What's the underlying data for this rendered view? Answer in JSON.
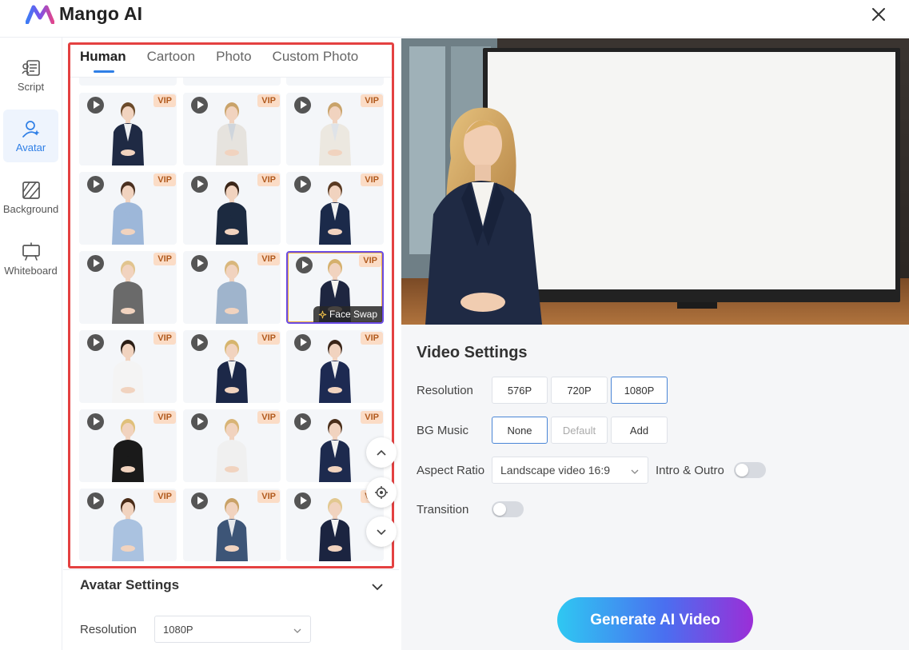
{
  "app": {
    "name": "Mango AI"
  },
  "sidebar": {
    "items": [
      {
        "label": "Script",
        "icon": "script-icon"
      },
      {
        "label": "Avatar",
        "icon": "avatar-icon",
        "active": true
      },
      {
        "label": "Background",
        "icon": "background-icon"
      },
      {
        "label": "Whiteboard",
        "icon": "whiteboard-icon"
      }
    ]
  },
  "avatar_panel": {
    "tabs": [
      "Human",
      "Cartoon",
      "Photo",
      "Custom Photo"
    ],
    "active_tab": "Human",
    "badge": "VIP",
    "face_swap_label": "Face Swap",
    "selected_index": 5
  },
  "avatar_settings": {
    "title": "Avatar Settings",
    "resolution_label": "Resolution",
    "resolution_value": "1080P"
  },
  "video_settings": {
    "title": "Video Settings",
    "resolution": {
      "label": "Resolution",
      "options": [
        "576P",
        "720P",
        "1080P"
      ],
      "selected": "1080P"
    },
    "bg_music": {
      "label": "BG Music",
      "options": [
        "None",
        "Default",
        "Add"
      ],
      "selected": "None"
    },
    "aspect_ratio": {
      "label": "Aspect Ratio",
      "value": "Landscape video 16:9"
    },
    "intro_outro": {
      "label": "Intro & Outro",
      "on": false
    },
    "transition": {
      "label": "Transition",
      "on": false
    }
  },
  "generate_button": "Generate AI Video",
  "colors": {
    "accent": "#2f7fe6",
    "highlight_box": "#e44141",
    "vip_bg": "#fbdcc6"
  }
}
